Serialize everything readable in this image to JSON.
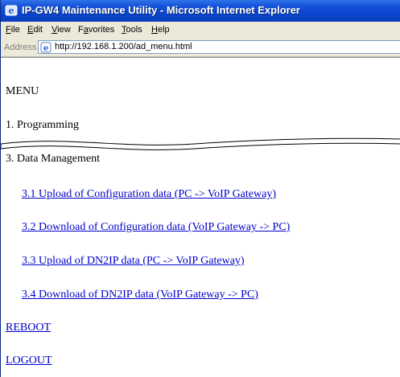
{
  "window": {
    "title": "IP-GW4 Maintenance Utility - Microsoft Internet Explorer"
  },
  "menubar": {
    "items": [
      {
        "label": "File",
        "mnemonic": "F"
      },
      {
        "label": "Edit",
        "mnemonic": "E"
      },
      {
        "label": "View",
        "mnemonic": "V"
      },
      {
        "label": "Favorites",
        "mnemonic": "a"
      },
      {
        "label": "Tools",
        "mnemonic": "T"
      },
      {
        "label": "Help",
        "mnemonic": "H"
      }
    ]
  },
  "address": {
    "label": "Address",
    "url": "http://192.168.1.200/ad_menu.html"
  },
  "content": {
    "heading": "MENU",
    "programming": "1. Programming",
    "data_management": "3. Data Management",
    "links": [
      "3.1 Upload of Configuration data (PC -> VoIP Gateway)",
      "3.2 Download of Configuration data (VoIP Gateway -> PC)",
      "3.3 Upload of DN2IP data (PC -> VoIP Gateway)",
      "3.4 Download of DN2IP data (VoIP Gateway -> PC)"
    ],
    "reboot": "REBOOT",
    "logout": "LOGOUT"
  },
  "colors": {
    "titlebar": "#0a45d0",
    "link": "#0000cc",
    "chrome": "#ece9d8"
  }
}
